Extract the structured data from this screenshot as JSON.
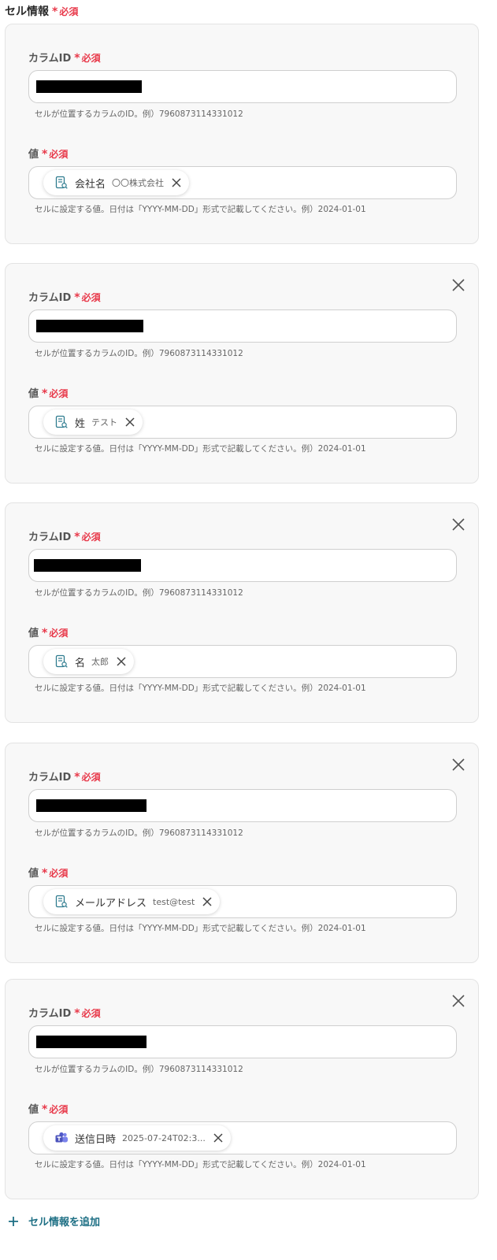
{
  "section": {
    "title": "セル情報",
    "required": "必須",
    "asterisk": "*"
  },
  "labels": {
    "column_id": "カラムID",
    "value": "値",
    "column_hint": "セルが位置するカラムのID。例）7960873114331012",
    "value_hint": "セルに設定する値。日付は「YYYY-MM-DD」形式で記載してください。例）2024-01-01"
  },
  "cards": [
    {
      "chip": {
        "icon": "form-output-icon",
        "name": "会社名",
        "value": "〇〇株式会社"
      }
    },
    {
      "chip": {
        "icon": "form-output-icon",
        "name": "姓",
        "value": "テスト"
      }
    },
    {
      "chip": {
        "icon": "form-output-icon",
        "name": "名",
        "value": "太郎"
      }
    },
    {
      "chip": {
        "icon": "form-output-icon",
        "name": "メールアドレス",
        "value": "test@test"
      }
    },
    {
      "chip": {
        "icon": "teams-icon",
        "name": "送信日時",
        "value": "2025-07-24T02:3..."
      }
    }
  ],
  "add_button": {
    "label": "セル情報を追加"
  },
  "colors": {
    "required": "#e8394a",
    "accent": "#1d6f84",
    "teams": "#5059c9"
  }
}
